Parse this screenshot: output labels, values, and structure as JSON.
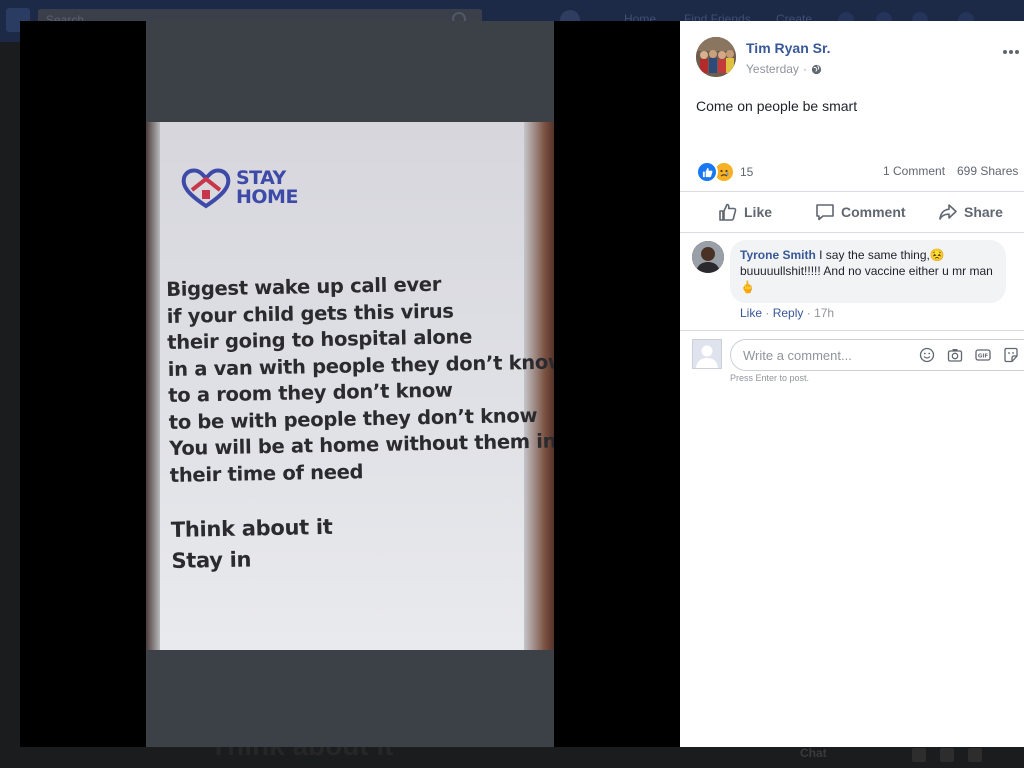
{
  "background": {
    "search_placeholder": "Search",
    "nav_home": "Home",
    "nav_find_friends": "Find Friends",
    "nav_create": "Create",
    "behind_text": "Think about it",
    "chat_label": "Chat"
  },
  "photo": {
    "logo_line1": "STAY",
    "logo_line2": "HOME",
    "lines": [
      "Biggest wake up call ever",
      "if your child gets this virus",
      "their going to hospital alone",
      "in a van with people they don’t know",
      "to a room they don’t know",
      "to be with people they don’t know",
      "You will be at home without them in",
      "their time of need"
    ],
    "closing": [
      "Think about it",
      "Stay in"
    ]
  },
  "post": {
    "author": "Tim Ryan Sr.",
    "time": "Yesterday",
    "separator": "·",
    "text": "Come on people be smart",
    "reaction_count": "15",
    "comments_count": "1 Comment",
    "shares_count": "699 Shares",
    "actions": {
      "like": "Like",
      "comment": "Comment",
      "share": "Share"
    }
  },
  "comment": {
    "author": "Tyrone Smith",
    "text": "I say the same thing,😣 buuuuullshit!!!!! And no vaccine either u mr man 🖕",
    "like": "Like",
    "reply": "Reply",
    "sep": "·",
    "time": "17h"
  },
  "composer": {
    "placeholder": "Write a comment...",
    "hint": "Press Enter to post.",
    "gif_label": "GIF"
  },
  "colors": {
    "link_blue": "#385898",
    "like_blue": "#1877f2",
    "logo_blue": "#3e4aa8",
    "logo_red": "#c8364a"
  }
}
